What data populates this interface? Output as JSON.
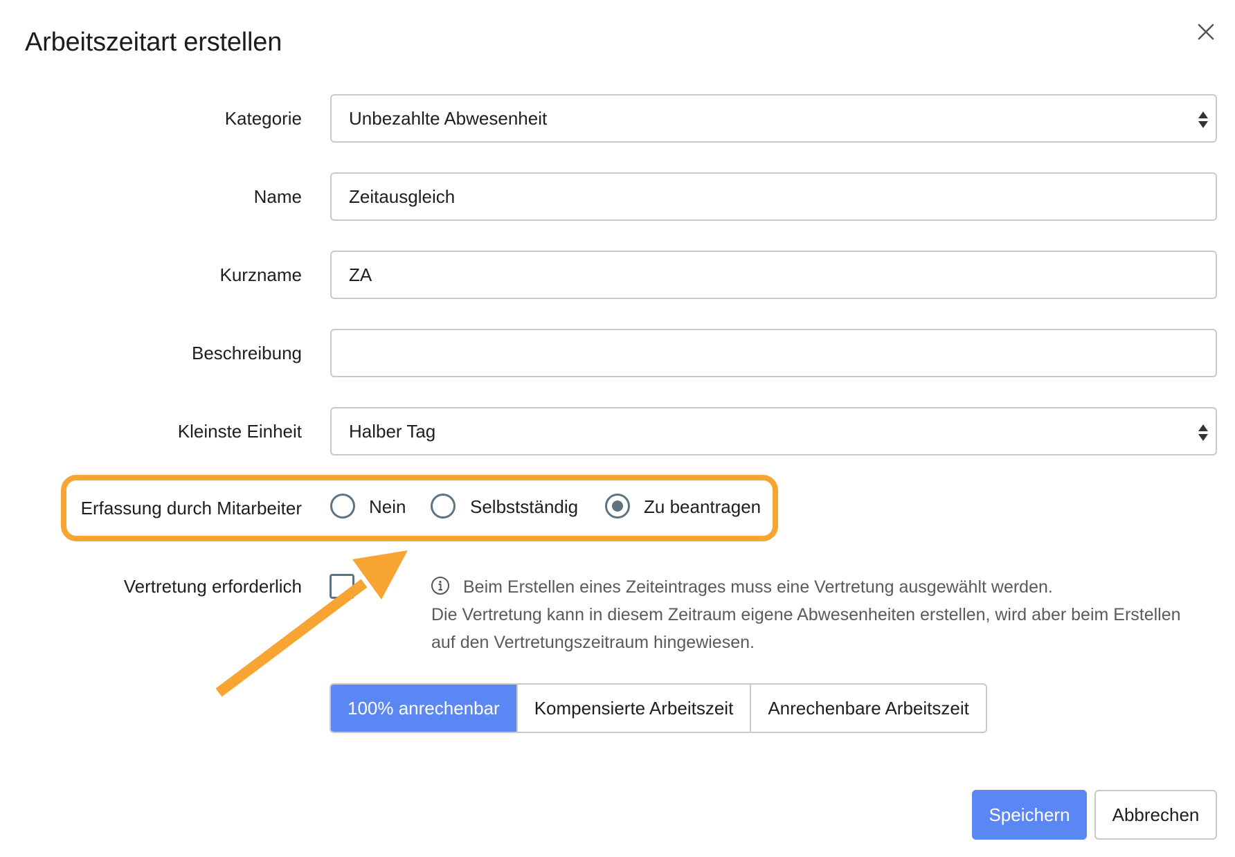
{
  "dialog": {
    "title": "Arbeitszeitart erstellen",
    "close_icon": "close-icon"
  },
  "form": {
    "kategorie": {
      "label": "Kategorie",
      "value": "Unbezahlte Abwesenheit"
    },
    "name": {
      "label": "Name",
      "value": "Zeitausgleich"
    },
    "kurzname": {
      "label": "Kurzname",
      "value": "ZA"
    },
    "beschreibung": {
      "label": "Beschreibung",
      "value": ""
    },
    "kleinste_einheit": {
      "label": "Kleinste Einheit",
      "value": "Halber Tag"
    },
    "erfassung": {
      "label": "Erfassung durch Mitarbeiter",
      "options": [
        "Nein",
        "Selbstständig",
        "Zu beantragen"
      ],
      "selected": "Zu beantragen"
    },
    "vertretung": {
      "label": "Vertretung erforderlich",
      "checked": false,
      "info_line1": "Beim Erstellen eines Zeiteintrages muss eine Vertretung ausgewählt werden.",
      "info_line2": "Die Vertretung kann in diesem Zeitraum eigene Abwesenheiten erstellen, wird aber beim Erstellen",
      "info_line3": "auf den Vertretungszeitraum hingewiesen."
    },
    "anrechnung": {
      "options": [
        "100% anrechenbar",
        "Kompensierte Arbeitszeit",
        "Anrechenbare Arbeitszeit"
      ],
      "selected": "100% anrechenbar"
    }
  },
  "actions": {
    "save_label": "Speichern",
    "cancel_label": "Abbrechen"
  },
  "colors": {
    "primary": "#5b87f5",
    "highlight": "#f8a433",
    "radio": "#5d7382"
  }
}
